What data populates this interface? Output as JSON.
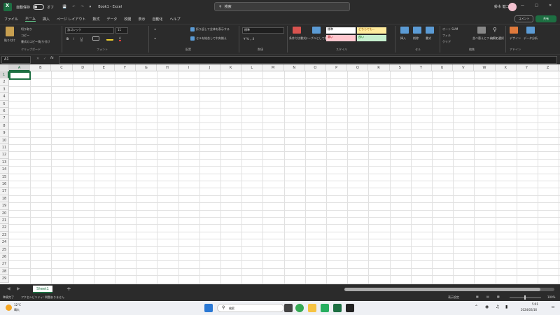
{
  "titlebar": {
    "autosave": "自動保存",
    "toggle_state": "オフ",
    "doc_title": "Book1 - Excel",
    "search_placeholder": "検索",
    "user_name": "鈴木 健二",
    "comment_button": "コメント",
    "share_button": "共有"
  },
  "tabs": [
    "ファイル",
    "ホーム",
    "挿入",
    "ページ レイアウト",
    "数式",
    "データ",
    "校閲",
    "表示",
    "自動化",
    "ヘルプ"
  ],
  "ribbon": {
    "clipboard": {
      "paste": "貼り付け",
      "cut": "切り取り",
      "copy": "コピー",
      "format_painter": "書式のコピー/貼り付け",
      "group": "クリップボード"
    },
    "font": {
      "name": "游ゴシック",
      "size": "11",
      "group": "フォント"
    },
    "align": {
      "wrap": "折り返して全体を表示する",
      "merge": "セルを結合して中央揃え",
      "group": "配置"
    },
    "number": {
      "format": "標準",
      "group": "数値"
    },
    "styles": {
      "cond": "条件付き書式",
      "table": "テーブルとして書式設定",
      "std": "標準",
      "neutral": "どちらでも...",
      "bad": "悪い",
      "good": "良い",
      "group": "スタイル"
    },
    "cells": {
      "insert": "挿入",
      "delete": "削除",
      "format": "書式",
      "group": "セル"
    },
    "editing": {
      "autosum": "オート SUM",
      "fill": "フィル",
      "clear": "クリア",
      "sort": "並べ替えとフィルター",
      "find": "検索と選択",
      "group": "編集"
    },
    "design": {
      "ideas": "デザイン",
      "analyze": "データ分析",
      "group": "アドイン"
    }
  },
  "formula": {
    "namebox": "A1",
    "fx": "fx",
    "value": ""
  },
  "columns": [
    "A",
    "B",
    "C",
    "D",
    "E",
    "F",
    "G",
    "H",
    "I",
    "J",
    "K",
    "L",
    "M",
    "N",
    "O",
    "P",
    "Q",
    "R",
    "S",
    "T",
    "U",
    "V",
    "W",
    "X",
    "Y",
    "Z"
  ],
  "rows": [
    "1",
    "2",
    "3",
    "4",
    "5",
    "6",
    "7",
    "8",
    "9",
    "10",
    "11",
    "12",
    "13",
    "14",
    "15",
    "16",
    "17",
    "18",
    "19",
    "20",
    "21",
    "22",
    "23",
    "24",
    "25",
    "26",
    "27",
    "28",
    "29"
  ],
  "sheet": {
    "name": "Sheet1",
    "add": "+"
  },
  "status": {
    "ready": "準備完了",
    "accessibility": "アクセシビリティ: 問題ありません",
    "display_settings": "表示設定",
    "zoom": "100%"
  },
  "taskbar": {
    "weather_temp": "12°C",
    "weather_desc": "晴れ",
    "search": "検索",
    "time": "5:01",
    "date": "2024/03/16"
  },
  "colors": {
    "accent": "#1d6f42",
    "titlebar": "#2b2b2b",
    "share": "#1d6f42"
  }
}
